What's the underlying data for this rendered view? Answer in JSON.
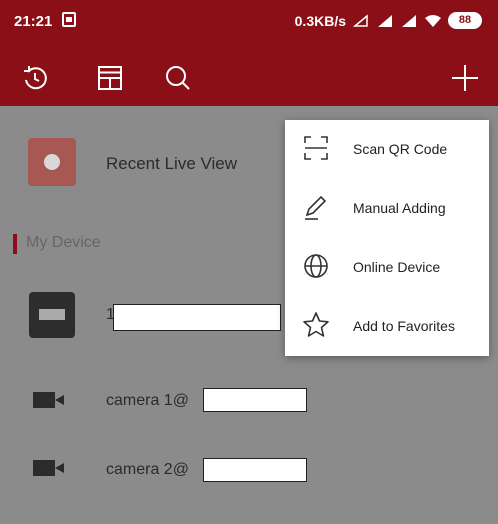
{
  "status_bar": {
    "time": "21:21",
    "network_speed": "0.3KB/s",
    "battery": "88"
  },
  "toolbar": {
    "icons": [
      "history-icon",
      "layout-icon",
      "search-icon",
      "add-icon"
    ]
  },
  "list": {
    "recent_live_view": "Recent Live View",
    "section_title": "My Device",
    "device_name_prefix": "1",
    "cameras": [
      {
        "label": "camera 1@"
      },
      {
        "label": "camera 2@"
      }
    ]
  },
  "add_menu": {
    "items": [
      {
        "label": "Scan QR Code",
        "icon": "qr-scan-icon"
      },
      {
        "label": "Manual Adding",
        "icon": "pencil-icon"
      },
      {
        "label": "Online Device",
        "icon": "globe-icon"
      },
      {
        "label": "Add to Favorites",
        "icon": "star-icon"
      }
    ]
  }
}
